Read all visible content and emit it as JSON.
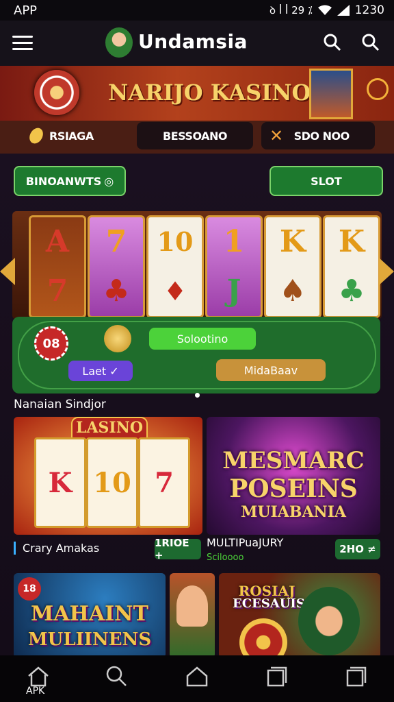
{
  "status_bar": {
    "left": "APP",
    "right": "ꝺ ꟾ ꟾ 29 ⁒",
    "time": "1230"
  },
  "app_bar": {
    "title": "Undamsia"
  },
  "banner": {
    "title": "NARIJO KASINO"
  },
  "tabs": [
    {
      "label": "RSIAGA"
    },
    {
      "label": "BESSOANO"
    },
    {
      "label": "SDO NOO"
    }
  ],
  "actions": {
    "left_button": "BINOANWTS",
    "right_button": "SLOT"
  },
  "slot_reels": [
    {
      "top": "A",
      "bottom": "7"
    },
    {
      "top": "7",
      "bottom": "♣"
    },
    {
      "top": "10",
      "bottom": "♦"
    },
    {
      "top": "1",
      "bottom": "J"
    },
    {
      "top": "K",
      "bottom": "♠"
    },
    {
      "top": "K",
      "bottom": "♣"
    }
  ],
  "table": {
    "chip_value": "08",
    "green_button": "Solootino",
    "purple_button": "Laet ✓",
    "gold_button": "MidaBaav"
  },
  "section": {
    "title": "Nanaian Sindjor"
  },
  "cards": [
    {
      "badge": "LASINO",
      "reels": [
        "K",
        "10",
        "7"
      ],
      "caption": "Crary Amakas",
      "tag": "1RIOE +"
    },
    {
      "promo_lines": [
        "MESMARC",
        "POSEINS",
        "MUIABANIA"
      ],
      "caption": "MULTIPuaJURY",
      "subcaption": "Sciloooo",
      "tag": "2HO ≠"
    },
    {
      "corner": "18",
      "promo_lines": [
        "MAHAINT",
        "MULIINENS"
      ]
    },
    {},
    {
      "promo_lines": [
        "ROSIAJ",
        "ECESAUIS"
      ]
    }
  ],
  "bottom_nav": {
    "apk_label": "APK"
  },
  "colors": {
    "accent_gold": "#f7d36a",
    "accent_green": "#1d7a2e",
    "banner_red": "#b3411c"
  }
}
